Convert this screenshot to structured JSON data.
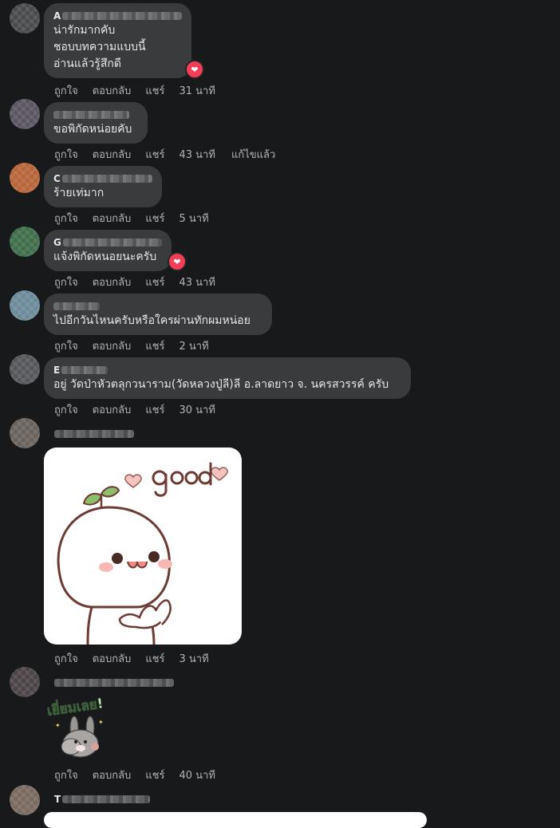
{
  "actions": {
    "like": "ถูกใจ",
    "reply": "ตอบกลับ",
    "share": "แชร์"
  },
  "comments": [
    {
      "name_initial": "A",
      "lines": [
        "น่ารักมากคับ",
        "ชอบบทความแบบนี้",
        "อ่านแล้วรู้สึกดี"
      ],
      "time": "31 นาที",
      "reaction": "heart-icon"
    },
    {
      "name_initial": "",
      "lines": [
        "ขอพิกัดหน่อยคับ"
      ],
      "time": "43 นาที",
      "edited": "แก้ไขแล้ว"
    },
    {
      "name_initial": "C",
      "lines": [
        "ร้ายเท่มาก"
      ],
      "time": "5 นาที"
    },
    {
      "name_initial": "G",
      "lines": [
        "แจ้งพิกัดหนอยนะครับ"
      ],
      "time": "43 นาที",
      "reaction": "heart-icon"
    },
    {
      "name_initial": "",
      "lines": [
        "ไปอีกวันไหนครับหรือใครผ่านทักผมหน่อย"
      ],
      "time": "2 นาที"
    },
    {
      "name_initial": "E",
      "lines": [
        "อยู่ วัดป่าหัวตลุกวนาราม(วัดหลวงปู่ลี)ลี อ.ลาดยาว จ. นครสวรรค์ ครับ"
      ],
      "time": "30 นาที"
    },
    {
      "name_initial": "",
      "sticker_text": "good",
      "time": "3 นาที"
    },
    {
      "name_initial": "",
      "sticker_text": "เยี่ยมเลย!",
      "time": "40 นาที"
    },
    {
      "name_initial": "T"
    }
  ]
}
